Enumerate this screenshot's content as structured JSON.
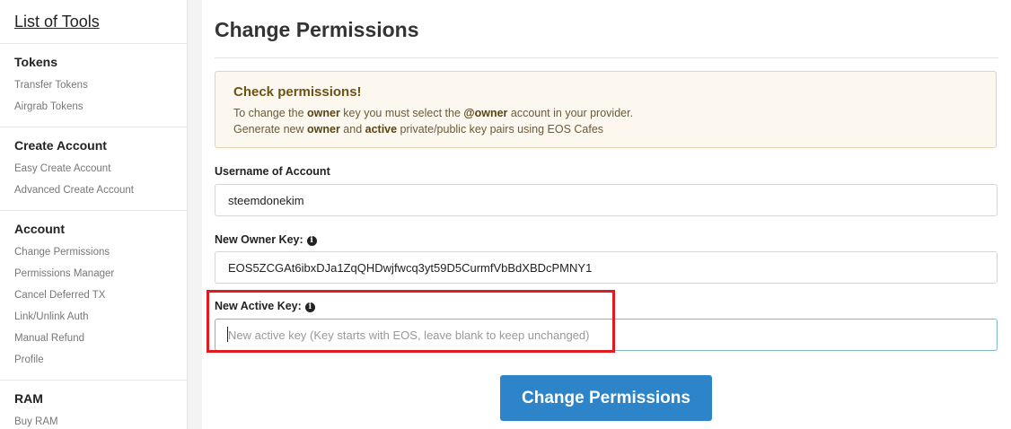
{
  "sidebar": {
    "title": "List of Tools",
    "groups": [
      {
        "heading": "Tokens",
        "links": [
          "Transfer Tokens",
          "Airgrab Tokens"
        ]
      },
      {
        "heading": "Create Account",
        "links": [
          "Easy Create Account",
          "Advanced Create Account"
        ]
      },
      {
        "heading": "Account",
        "links": [
          "Change Permissions",
          "Permissions Manager",
          "Cancel Deferred TX",
          "Link/Unlink Auth",
          "Manual Refund",
          "Profile"
        ]
      },
      {
        "heading": "RAM",
        "links": [
          "Buy RAM"
        ]
      }
    ]
  },
  "main": {
    "title": "Change Permissions",
    "alert": {
      "heading": "Check permissions!",
      "line1": {
        "a": "To change the ",
        "b": "owner",
        "c": " key you must select the ",
        "d": "@owner",
        "e": " account in your provider."
      },
      "line2": {
        "a": "Generate new ",
        "b": "owner",
        "c": " and ",
        "d": "active",
        "e": " private/public key pairs using EOS Cafes"
      }
    },
    "username": {
      "label": "Username of Account",
      "value": "steemdonekim"
    },
    "owner_key": {
      "label": "New Owner Key:",
      "value": "EOS5ZCGAt6ibxDJa1ZqQHDwjfwcq3yt59D5CurmfVbBdXBDcPMNY1"
    },
    "active_key": {
      "label": "New Active Key:",
      "value": "",
      "placeholder": "New active key (Key starts with EOS, leave blank to keep unchanged)"
    },
    "info_glyph": "i",
    "submit_label": "Change Permissions"
  },
  "colors": {
    "primary_button": "#2d84c9",
    "highlight": "#e11b22",
    "alert_bg": "#fcf8ef"
  }
}
